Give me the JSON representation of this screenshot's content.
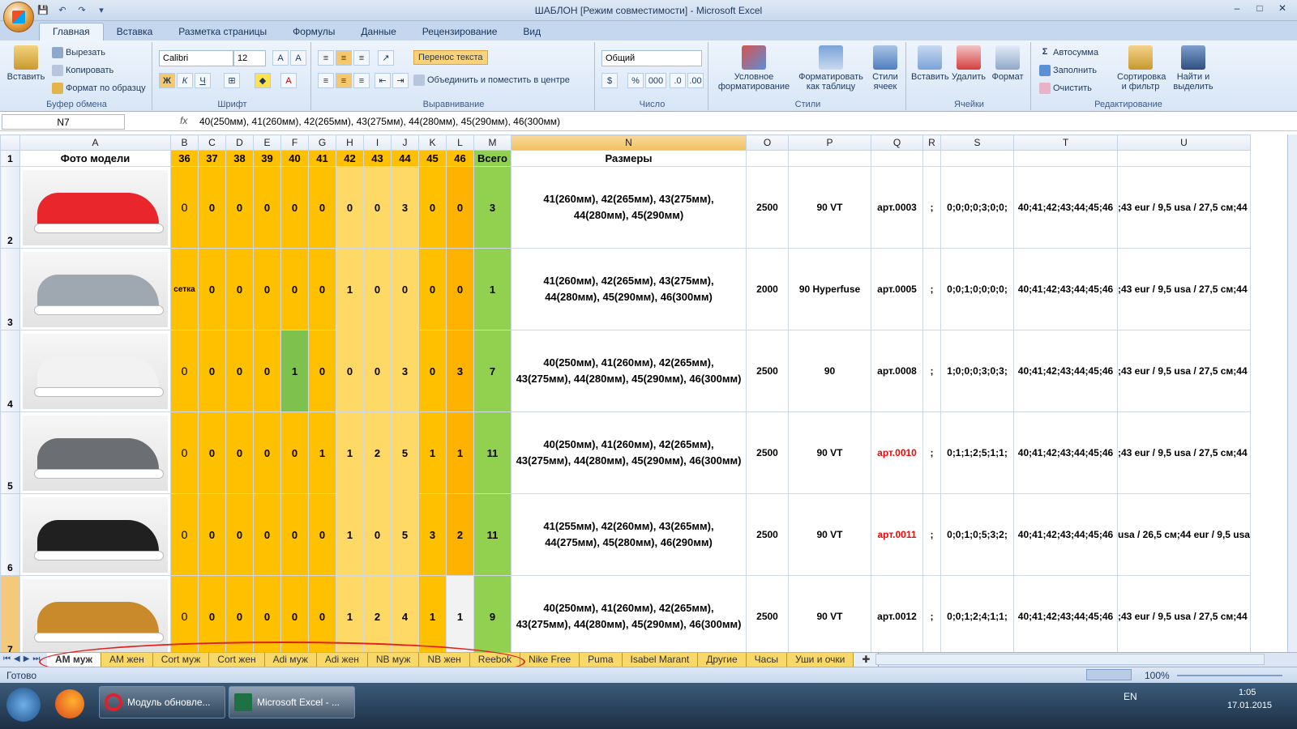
{
  "window": {
    "title": "ШАБЛОН  [Режим совместимости] - Microsoft Excel"
  },
  "ribbon_tabs": [
    "Главная",
    "Вставка",
    "Разметка страницы",
    "Формулы",
    "Данные",
    "Рецензирование",
    "Вид"
  ],
  "clipboard": {
    "paste": "Вставить",
    "cut": "Вырезать",
    "copy": "Копировать",
    "format_painter": "Формат по образцу",
    "label": "Буфер обмена"
  },
  "font": {
    "name": "Calibri",
    "size": "12",
    "bold": "Ж",
    "italic": "К",
    "underline": "Ч",
    "label": "Шрифт"
  },
  "alignment": {
    "wrap": "Перенос текста",
    "merge": "Объединить и поместить в центре",
    "label": "Выравнивание"
  },
  "number": {
    "format": "Общий",
    "percent": "%",
    "thousands": "000",
    "label": "Число"
  },
  "styles": {
    "cond": "Условное форматирование",
    "table": "Форматировать как таблицу",
    "cell": "Стили ячеек",
    "label": "Стили"
  },
  "cells": {
    "insert": "Вставить",
    "delete": "Удалить",
    "format": "Формат",
    "label": "Ячейки"
  },
  "editing": {
    "autosum": "Автосумма",
    "fill": "Заполнить",
    "clear": "Очистить",
    "sort": "Сортировка и фильтр",
    "find": "Найти и выделить",
    "label": "Редактирование"
  },
  "formula_bar": {
    "name_box": "N7",
    "fx": "fx",
    "formula": "40(250мм), 41(260мм), 42(265мм), 43(275мм), 44(280мм), 45(290мм), 46(300мм)"
  },
  "columns": [
    "A",
    "B",
    "C",
    "D",
    "E",
    "F",
    "G",
    "H",
    "I",
    "J",
    "K",
    "L",
    "M",
    "N",
    "O",
    "P",
    "Q",
    "R",
    "S",
    "T",
    "U"
  ],
  "header_row": {
    "num": "1",
    "photo": "Фото модели",
    "sizes": [
      "36",
      "37",
      "38",
      "39",
      "40",
      "41",
      "42",
      "43",
      "44",
      "45",
      "46"
    ],
    "total": "Всего",
    "sizes_label": "Размеры"
  },
  "rows": [
    {
      "num": "2",
      "shoe_color": "#e8262b",
      "vals": [
        "0",
        "0",
        "0",
        "0",
        "0",
        "0",
        "0",
        "0",
        "3",
        "0",
        "0"
      ],
      "total": "3",
      "sizes": "41(260мм), 42(265мм), 43(275мм), 44(280мм), 45(290мм)",
      "price": "2500",
      "model": "90 VT",
      "art": "арт.0003",
      "art_red": false,
      "r": ";",
      "s": "0;0;0;0;3;0;0;",
      "t": "40;41;42;43;44;45;46",
      "u": ";43 eur / 9,5 usa / 27,5 см;44"
    },
    {
      "num": "3",
      "shoe_color": "#9fa7b0",
      "vals": [
        "сетка",
        "0",
        "0",
        "0",
        "0",
        "0",
        "1",
        "0",
        "0",
        "0",
        "0"
      ],
      "total": "1",
      "sizes": "41(260мм), 42(265мм), 43(275мм), 44(280мм), 45(290мм), 46(300мм)",
      "price": "2000",
      "model": "90 Hyperfuse",
      "art": "арт.0005",
      "art_red": false,
      "r": ";",
      "s": "0;0;1;0;0;0;0;",
      "t": "40;41;42;43;44;45;46",
      "u": ";43 eur / 9,5 usa / 27,5 см;44"
    },
    {
      "num": "4",
      "shoe_color": "#f2f2f2",
      "vals": [
        "0",
        "0",
        "0",
        "0",
        "1",
        "0",
        "0",
        "0",
        "3",
        "0",
        "3"
      ],
      "total": "7",
      "sizes": "40(250мм), 41(260мм), 42(265мм), 43(275мм), 44(280мм), 45(290мм), 46(300мм)",
      "price": "2500",
      "model": "90",
      "art": "арт.0008",
      "art_red": false,
      "r": ";",
      "s": "1;0;0;0;3;0;3;",
      "t": "40;41;42;43;44;45;46",
      "u": ";43 eur / 9,5 usa / 27,5 см;44"
    },
    {
      "num": "5",
      "shoe_color": "#6b6e72",
      "vals": [
        "0",
        "0",
        "0",
        "0",
        "0",
        "1",
        "1",
        "2",
        "5",
        "1",
        "1"
      ],
      "total": "11",
      "sizes": "40(250мм), 41(260мм), 42(265мм), 43(275мм), 44(280мм), 45(290мм), 46(300мм)",
      "price": "2500",
      "model": "90 VT",
      "art": "арт.0010",
      "art_red": true,
      "r": ";",
      "s": "0;1;1;2;5;1;1;",
      "t": "40;41;42;43;44;45;46",
      "u": ";43 eur / 9,5 usa / 27,5 см;44"
    },
    {
      "num": "6",
      "shoe_color": "#202020",
      "vals": [
        "0",
        "0",
        "0",
        "0",
        "0",
        "0",
        "1",
        "0",
        "5",
        "3",
        "2"
      ],
      "total": "11",
      "sizes": "41(255мм), 42(260мм), 43(265мм), 44(275мм), 45(280мм), 46(290мм)",
      "price": "2500",
      "model": "90 VT",
      "art": "арт.0011",
      "art_red": true,
      "r": ";",
      "s": "0;0;1;0;5;3;2;",
      "t": "40;41;42;43;44;45;46",
      "u": "usa / 26,5 см;44 eur / 9,5 usa"
    },
    {
      "num": "7",
      "shoe_color": "#c98a2b",
      "vals": [
        "0",
        "0",
        "0",
        "0",
        "0",
        "0",
        "1",
        "2",
        "4",
        "1",
        "1"
      ],
      "total": "9",
      "sizes": "40(250мм), 41(260мм), 42(265мм), 43(275мм), 44(280мм), 45(290мм), 46(300мм)",
      "price": "2500",
      "model": "90 VT",
      "art": "арт.0012",
      "art_red": false,
      "r": ";",
      "s": "0;0;1;2;4;1;1;",
      "t": "40;41;42;43;44;45;46",
      "u": ";43 eur / 9,5 usa / 27,5 см;44"
    }
  ],
  "sheets": [
    "АМ муж",
    "АМ жен",
    "Cort муж",
    "Cort жен",
    "Adi муж",
    "Adi жен",
    "NB муж",
    "NB жен",
    "Reebok",
    "Nike Free",
    "Puma",
    "Isabel Marant",
    "Другие",
    "Часы",
    "Уши и очки"
  ],
  "status": {
    "ready": "Готово",
    "zoom": "100%"
  },
  "taskbar": {
    "opera": "Модуль обновле...",
    "excel": "Microsoft Excel - ...",
    "lang": "EN",
    "time": "1:05",
    "date": "17.01.2015"
  }
}
